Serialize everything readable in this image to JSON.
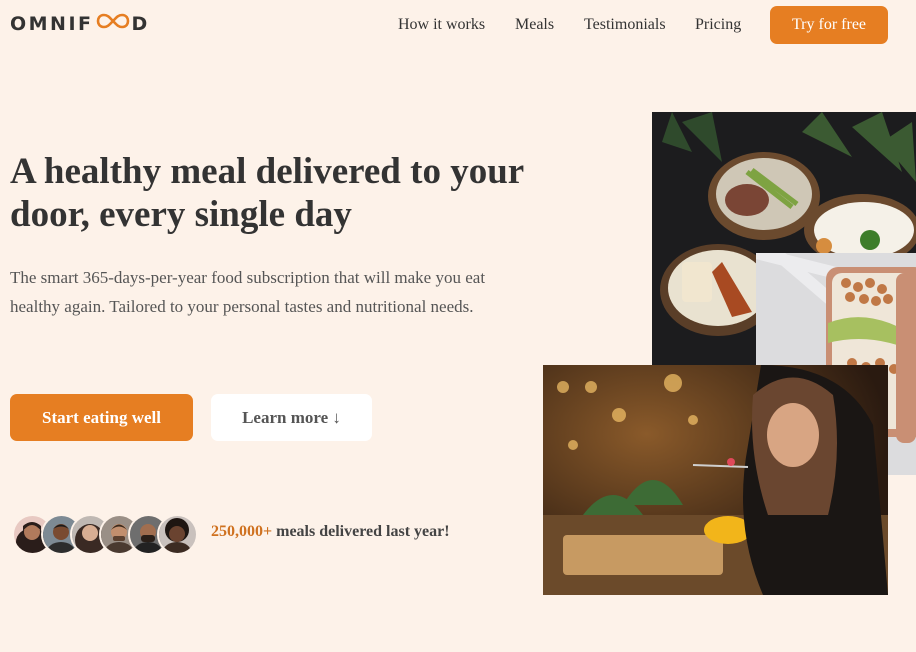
{
  "header": {
    "logo_text_before": "OMNIF",
    "logo_text_after": "D",
    "nav": [
      "How it works",
      "Meals",
      "Testimonials",
      "Pricing"
    ],
    "cta_label": "Try for free"
  },
  "hero": {
    "title": "A healthy meal delivered to your door, every single day",
    "description": "The smart 365-days-per-year food subscription that will make you eat healthy again. Tailored to your personal tastes and nutritional needs.",
    "primary_button": "Start eating well",
    "secondary_button": "Learn more ↓"
  },
  "delivered": {
    "count": "250,000+",
    "text": " meals delivered last year!"
  },
  "colors": {
    "background": "#fdf2e9",
    "accent": "#e67e22",
    "text": "#333333"
  }
}
